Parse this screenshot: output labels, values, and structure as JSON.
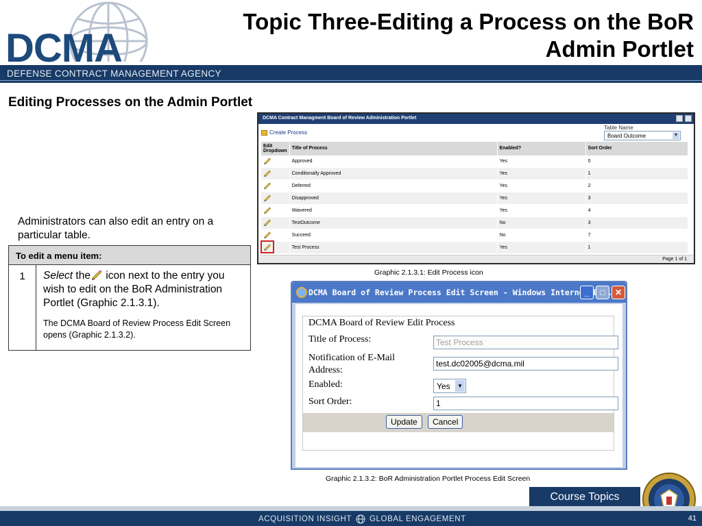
{
  "header": {
    "logo_text": "DCMA",
    "agency_name": "DEFENSE CONTRACT MANAGEMENT AGENCY",
    "title_line1": "Topic Three-Editing a Process on the BoR",
    "title_line2": "Admin Portlet"
  },
  "section_heading": "Editing Processes on the Admin Portlet",
  "intro_text": "Administrators can also edit an entry on a particular table.",
  "steps_table": {
    "header": "To edit a menu item:",
    "step_number": "1",
    "select_word": "Select",
    "instruction_part1": "the",
    "instruction_part2": "icon next to the entry you wish to edit on the BoR Administration Portlet (Graphic 2.1.3.1).",
    "result_text": "The DCMA Board of Review Process Edit Screen opens (Graphic 2.1.3.2)."
  },
  "portlet": {
    "title": "DCMA Contract Managment Board of Review Administration Portlet",
    "create_link": "Create Process",
    "table_name_label": "Table Name",
    "table_name_value": "Board Outcome",
    "columns": [
      "Edit Dropdown",
      "Title of Process",
      "Enabled?",
      "Sort Order"
    ],
    "rows": [
      {
        "title": "Approved",
        "enabled": "Yes",
        "sort": "0"
      },
      {
        "title": "Conditionally Approved",
        "enabled": "Yes",
        "sort": "1"
      },
      {
        "title": "Deferred",
        "enabled": "Yes",
        "sort": "2"
      },
      {
        "title": "Disapproved",
        "enabled": "Yes",
        "sort": "3"
      },
      {
        "title": "Waivered",
        "enabled": "Yes",
        "sort": "4"
      },
      {
        "title": "TestOutcome",
        "enabled": "No",
        "sort": "3"
      },
      {
        "title": "Succeed",
        "enabled": "No",
        "sort": "7"
      },
      {
        "title": "Test Process",
        "enabled": "Yes",
        "sort": "1"
      }
    ],
    "pager": "Page 1 of 1"
  },
  "caption1": "Graphic  2.1.3.1:  Edit Process icon",
  "edit_window": {
    "window_title": "DCMA Board of Review Process Edit Screen - Windows Internet E...",
    "form_heading": "DCMA Board of Review Edit Process",
    "title_label": "Title of Process:",
    "title_value": "Test Process",
    "email_label_line1": "Notification of E-Mail",
    "email_label_line2": "Address:",
    "email_value": "test.dc02005@dcma.mil",
    "enabled_label": "Enabled:",
    "enabled_value": "Yes",
    "sort_label": "Sort Order:",
    "sort_value": "1",
    "update_button": "Update",
    "cancel_button": "Cancel"
  },
  "caption2": "Graphic  2.1.3.2:  BoR Administration Portlet Process Edit Screen",
  "footer": {
    "course_topics": "Course Topics",
    "tagline_left": "ACQUISITION INSIGHT",
    "tagline_right": "GLOBAL ENGAGEMENT",
    "page_number": "41"
  },
  "colors": {
    "brand_navy": "#173a66",
    "portlet_titlebar": "#1f3f73",
    "highlight_red": "#d42020"
  }
}
